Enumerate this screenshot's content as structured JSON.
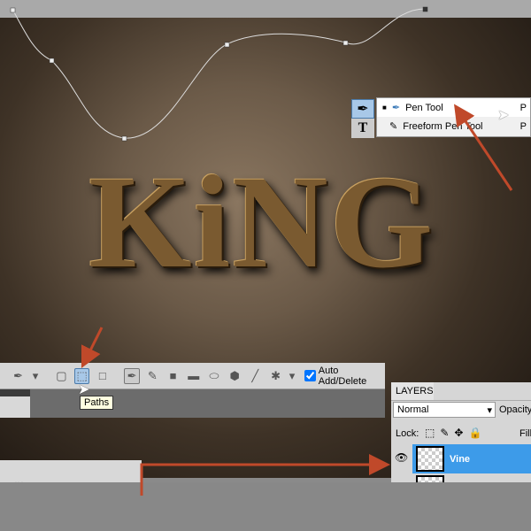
{
  "canvas": {
    "artwork_text": "KiNG"
  },
  "tool_menu": {
    "items": [
      {
        "label": "Pen Tool",
        "shortcut": "P",
        "selected": true
      },
      {
        "label": "Freeform Pen Tool",
        "shortcut": "P",
        "selected": false
      }
    ]
  },
  "options_bar": {
    "auto_add_delete_label": "Auto Add/Delete",
    "auto_add_delete_checked": true,
    "tooltip": "Paths"
  },
  "layers_panel": {
    "title": "LAYERS",
    "blend_mode": "Normal",
    "opacity_label": "Opacity",
    "lock_label": "Lock:",
    "fill_label": "Fill",
    "layers": [
      {
        "name": "Vine",
        "selected": true,
        "visible": true
      },
      {
        "name": "",
        "selected": false
      }
    ]
  },
  "colors": {
    "accent_arrow": "#c0492a",
    "selection": "#3d9be9"
  }
}
